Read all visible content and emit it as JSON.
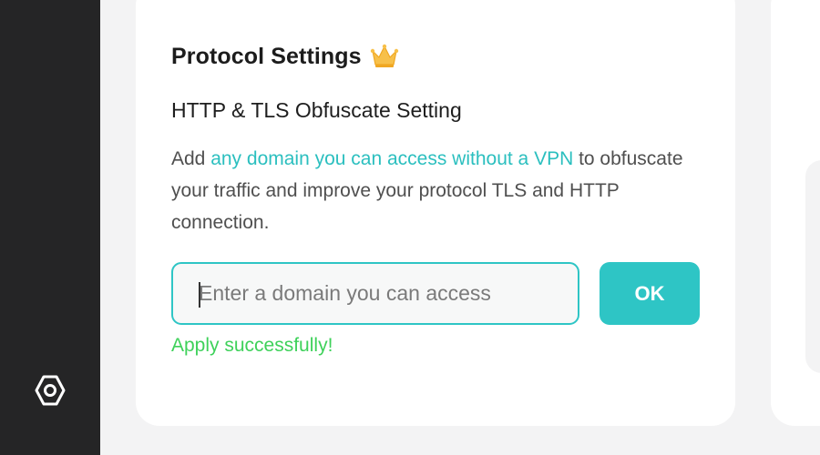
{
  "sidebar": {
    "settings_icon": "hexagon-settings-icon"
  },
  "card": {
    "title": "Protocol Settings",
    "title_icon": "crown-icon",
    "subtitle": "HTTP & TLS Obfuscate Setting",
    "description": {
      "prefix": "Add ",
      "link": "any domain you can access without a VPN",
      "suffix": " to obfuscate your traffic and improve your protocol TLS and HTTP connection."
    },
    "domain_input": {
      "placeholder": "Enter a domain you can access",
      "value": ""
    },
    "ok_label": "OK",
    "status_message": "Apply successfully!"
  },
  "colors": {
    "accent": "#2ec5c5",
    "success": "#3ed15a",
    "sidebar_bg": "#252526",
    "page_bg": "#f3f3f4"
  }
}
